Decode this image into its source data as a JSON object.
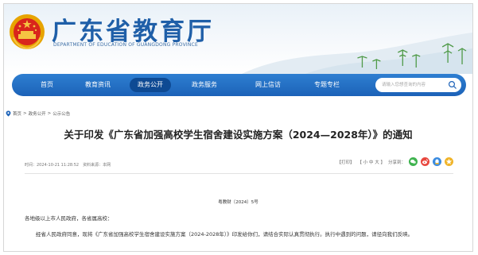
{
  "header": {
    "title": "广东省教育厅",
    "subtitle": "DEPARTMENT OF EDUCATION OF GUANGDONG PROVINCE"
  },
  "nav": {
    "items": [
      {
        "label": "首页"
      },
      {
        "label": "教育资讯"
      },
      {
        "label": "政务公开"
      },
      {
        "label": "政务服务"
      },
      {
        "label": "网上信访"
      },
      {
        "label": "专题专栏"
      }
    ],
    "active_index": 2,
    "search_placeholder": "请输入您想查询的内容"
  },
  "breadcrumb": [
    "首页",
    "政务公开",
    "公示公告"
  ],
  "breadcrumb_sep": ">",
  "article": {
    "title": "关于印发《广东省加强高校学生宿舍建设实施方案（2024—2028年）》的通知",
    "meta": "时间：2024-10-21 11:28:52　资料来源：本网",
    "print_label": "【打印】",
    "size_label": "【 小  中  大 】",
    "share_label": "分享到：",
    "doc_number": "粤教财〔2024〕5号",
    "salutation": "各地级以上市人民政府，各省属高校：",
    "body": "经省人民政府同意，现将《广东省加强高校学生宿舍建设实施方案（2024-2028年）》印发给你们，请结合实际认真贯彻执行。执行中遇到的问题，请径向我们反映。"
  },
  "share_icons": [
    {
      "name": "wechat-share-icon",
      "color": "#3fb34f"
    },
    {
      "name": "weibo-share-icon",
      "color": "#e8473e"
    },
    {
      "name": "qq-share-icon",
      "color": "#3a8be0"
    },
    {
      "name": "qzone-share-icon",
      "color": "#f0b429"
    }
  ],
  "colors": {
    "brand_blue": "#1f5fa8",
    "nav_blue": "#1c62b8",
    "nav_active": "#0e4a93"
  }
}
